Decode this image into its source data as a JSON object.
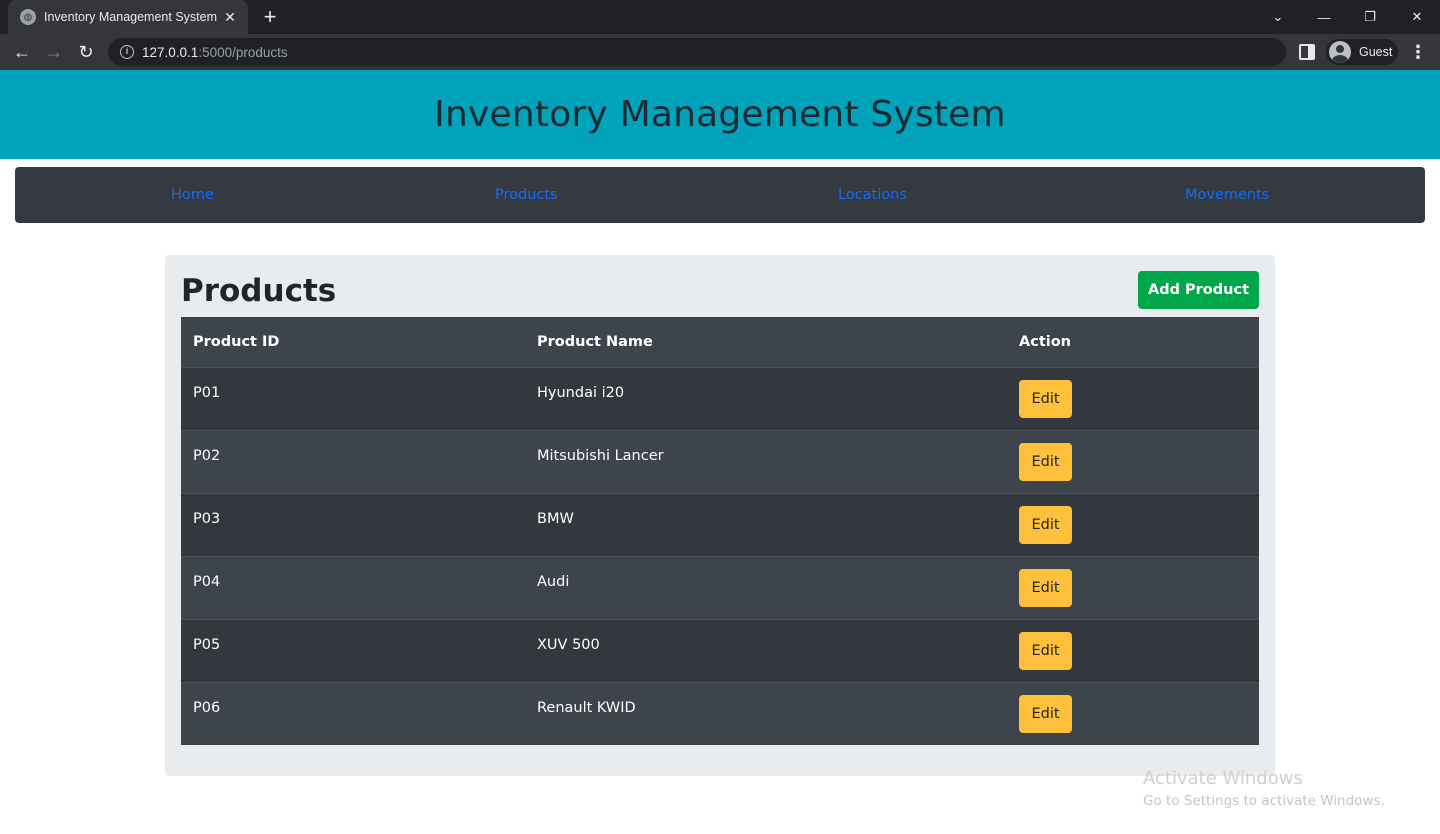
{
  "browser": {
    "tab_title": "Inventory Management System",
    "url_host": "127.0.0.1",
    "url_path": ":5000/products",
    "profile_label": "Guest"
  },
  "header": {
    "title": "Inventory Management System"
  },
  "nav": {
    "items": [
      {
        "label": "Home"
      },
      {
        "label": "Products"
      },
      {
        "label": "Locations"
      },
      {
        "label": "Movements"
      }
    ]
  },
  "main": {
    "heading": "Products",
    "add_button_label": "Add Product",
    "table": {
      "columns": [
        "Product ID",
        "Product Name",
        "Action"
      ],
      "rows": [
        {
          "id": "P01",
          "name": "Hyundai i20",
          "action": "Edit"
        },
        {
          "id": "P02",
          "name": "Mitsubishi Lancer",
          "action": "Edit"
        },
        {
          "id": "P03",
          "name": "BMW",
          "action": "Edit"
        },
        {
          "id": "P04",
          "name": "Audi",
          "action": "Edit"
        },
        {
          "id": "P05",
          "name": "XUV 500",
          "action": "Edit"
        },
        {
          "id": "P06",
          "name": "Renault KWID",
          "action": "Edit"
        }
      ]
    }
  },
  "watermark": {
    "line1": "Activate Windows",
    "line2": "Go to Settings to activate Windows."
  },
  "colors": {
    "header_bg": "#00a3b9",
    "navbar_bg": "#343a40",
    "nav_link": "#0d6efd",
    "add_button": "#00a74a",
    "edit_button": "#ffc13b",
    "table_dark": "#32383e",
    "table_light": "#3e444b"
  }
}
